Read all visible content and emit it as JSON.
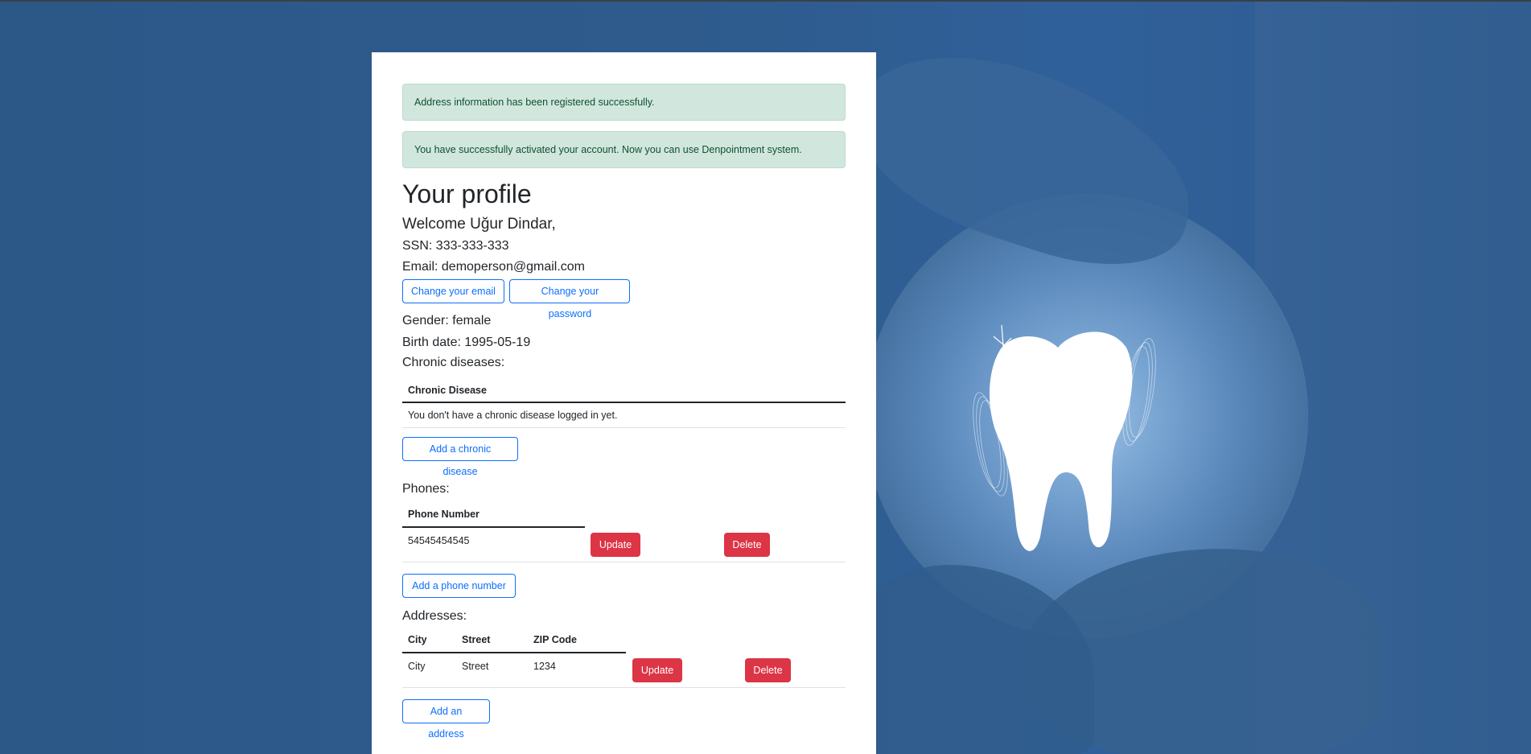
{
  "alerts": [
    {
      "text": "Address information has been registered successfully.",
      "type": "success"
    },
    {
      "text": "You have successfully activated your account. Now you can use Denpointment system.",
      "type": "success"
    }
  ],
  "profile": {
    "title": "Your profile",
    "welcome": "Welcome Uğur Dindar,",
    "ssn": "SSN: 333-333-333",
    "email": "Email: demoperson@gmail.com",
    "change_email_label": "Change your email",
    "change_password_label": "Change your password",
    "gender": "Gender: female",
    "birth_date": "Birth date: 1995-05-19"
  },
  "chronic": {
    "label": "Chronic diseases:",
    "columns": [
      "Chronic Disease"
    ],
    "empty_message": "You don't have a chronic disease logged in yet.",
    "add_label": "Add a chronic disease"
  },
  "phones": {
    "label": "Phones:",
    "columns": [
      "Phone Number"
    ],
    "rows": [
      {
        "number": "54545454545",
        "update_label": "Update",
        "delete_label": "Delete"
      }
    ],
    "add_label": "Add a phone number"
  },
  "addresses": {
    "label": "Addresses:",
    "columns": [
      "City",
      "Street",
      "ZIP Code"
    ],
    "rows": [
      {
        "city": "City",
        "street": "Street",
        "zip": "1234",
        "update_label": "Update",
        "delete_label": "Delete"
      }
    ],
    "add_label": "Add an address"
  },
  "colors": {
    "background": "#2d5a8b",
    "success_bg": "#d1e7dd",
    "success_text": "#0f5132",
    "primary": "#0d6efd",
    "danger": "#dc3545"
  }
}
